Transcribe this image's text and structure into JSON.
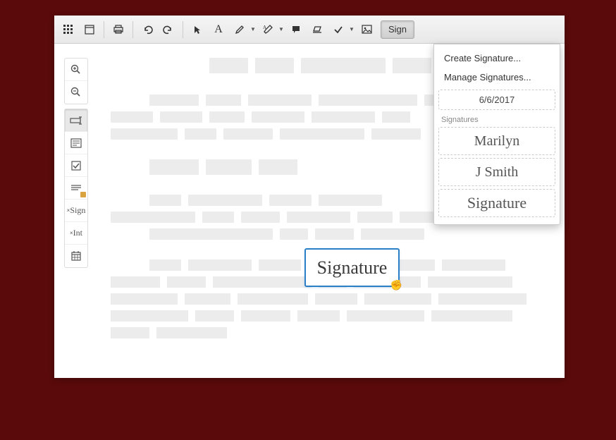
{
  "toolbar": {
    "sign_label": "Sign"
  },
  "dropdown": {
    "create_label": "Create Signature...",
    "manage_label": "Manage Signatures...",
    "date_value": "6/6/2017",
    "signatures_heading": "Signatures",
    "sig1": "Marilyn",
    "sig2": "J Smith",
    "sig3": "Signature"
  },
  "placed_signature": {
    "text": "Signature"
  },
  "sidebar": {
    "sign_label": "Sign",
    "int_label": "Int"
  }
}
